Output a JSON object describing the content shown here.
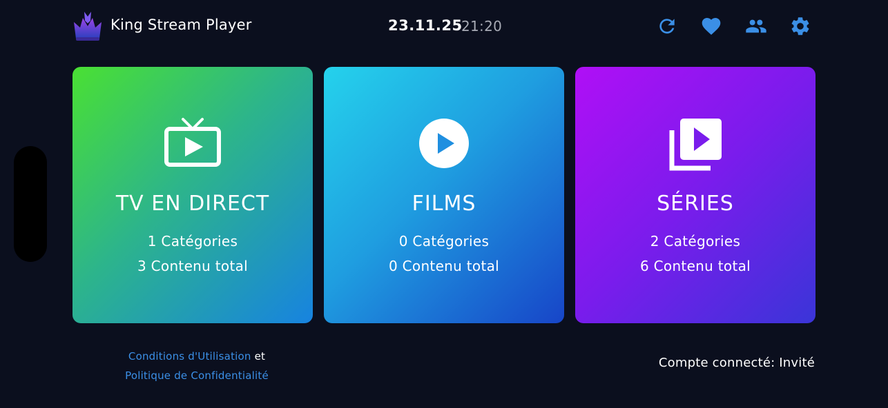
{
  "header": {
    "app_title": "King Stream Player",
    "date": "23.11.25",
    "time": "21:20",
    "icons": [
      "refresh-icon",
      "heart-icon",
      "users-icon",
      "settings-icon"
    ],
    "icon_color": "#3b8fe6"
  },
  "cards": [
    {
      "key": "live",
      "title": "TV EN DIRECT",
      "categories": "1 Catégories",
      "total": "3 Contenu total",
      "icon": "tv-play-icon",
      "gradient": [
        "#4ae033",
        "#2db58a",
        "#1783e0"
      ]
    },
    {
      "key": "films",
      "title": "FILMS",
      "categories": "0 Catégories",
      "total": "0 Contenu total",
      "icon": "play-circle-icon",
      "gradient": [
        "#25d2ec",
        "#1f9ee0",
        "#1745c8"
      ]
    },
    {
      "key": "series",
      "title": "SÉRIES",
      "categories": "2 Catégories",
      "total": "6 Contenu total",
      "icon": "video-library-icon",
      "gradient": [
        "#b00ff6",
        "#7a1cec",
        "#3a35d8"
      ]
    }
  ],
  "footer": {
    "terms_link": "Conditions d'Utilisation",
    "conjunction": "et",
    "privacy_link": "Politique de Confidentialité",
    "account_status": "Compte connecté: Invité"
  },
  "colors": {
    "background": "#0b0f1e",
    "link": "#3b8fe6",
    "time_text": "#a8abb5"
  }
}
